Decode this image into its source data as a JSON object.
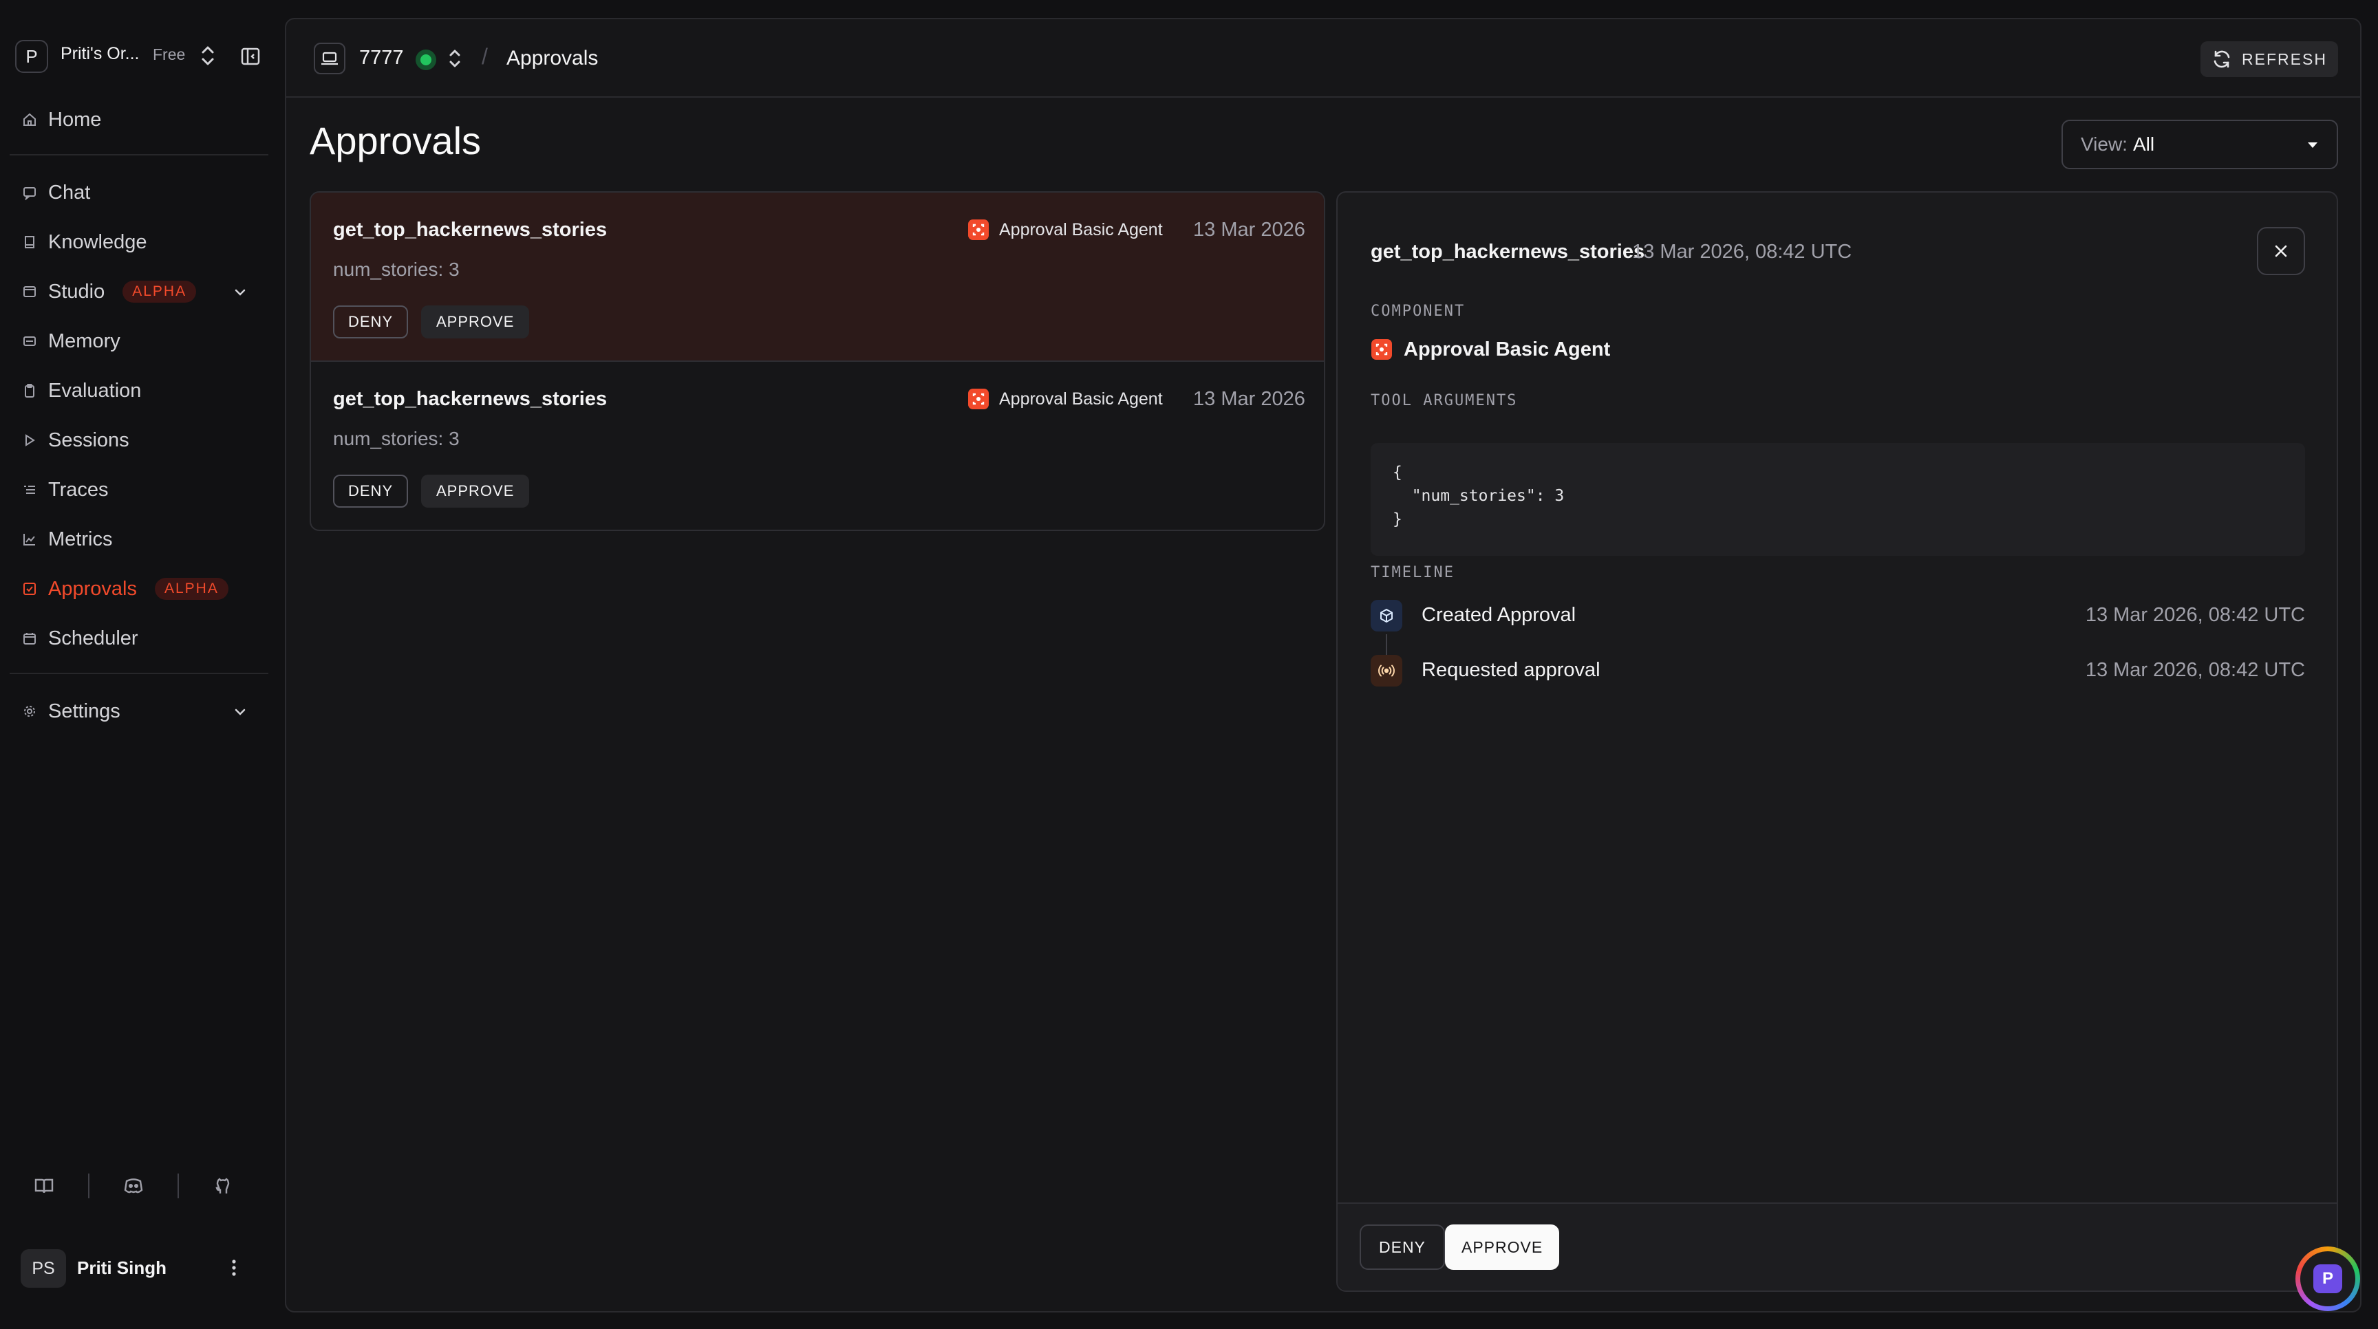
{
  "sidebar": {
    "org": {
      "initial": "P",
      "name": "Priti's Or...",
      "plan": "Free"
    },
    "nav": {
      "home": "Home",
      "chat": "Chat",
      "knowledge": "Knowledge",
      "studio": "Studio",
      "studio_badge": "ALPHA",
      "memory": "Memory",
      "evaluation": "Evaluation",
      "sessions": "Sessions",
      "traces": "Traces",
      "metrics": "Metrics",
      "approvals": "Approvals",
      "approvals_badge": "ALPHA",
      "scheduler": "Scheduler",
      "settings": "Settings"
    },
    "active_item": "approvals",
    "user": {
      "initials": "PS",
      "name": "Priti Singh"
    }
  },
  "topbar": {
    "env_name": "7777",
    "env_status": "online",
    "breadcrumb_separator": "/",
    "breadcrumb_page": "Approvals",
    "refresh_label": "REFRESH"
  },
  "page": {
    "title": "Approvals",
    "view_label": "View:",
    "view_value": "All"
  },
  "approvals": [
    {
      "tool": "get_top_hackernews_stories",
      "args": "num_stories: 3",
      "agent": "Approval Basic Agent",
      "date": "13 Mar 2026",
      "deny_label": "DENY",
      "approve_label": "APPROVE",
      "selected": true
    },
    {
      "tool": "get_top_hackernews_stories",
      "args": "num_stories: 3",
      "agent": "Approval Basic Agent",
      "date": "13 Mar 2026",
      "deny_label": "DENY",
      "approve_label": "APPROVE",
      "selected": false
    }
  ],
  "detail": {
    "tool": "get_top_hackernews_stories",
    "datetime": "13 Mar 2026, 08:42 UTC",
    "component_heading": "COMPONENT",
    "component_name": "Approval Basic Agent",
    "args_heading": "TOOL ARGUMENTS",
    "args_code": "{\n  \"num_stories\": 3\n}",
    "timeline_heading": "TIMELINE",
    "timeline": [
      {
        "label": "Created Approval",
        "time": "13 Mar 2026, 08:42 UTC",
        "icon": "cube-icon"
      },
      {
        "label": "Requested approval",
        "time": "13 Mar 2026, 08:42 UTC",
        "icon": "broadcast-icon"
      }
    ],
    "deny_label": "DENY",
    "approve_label": "APPROVE"
  },
  "fab": {
    "initial": "P"
  },
  "colors": {
    "accent": "#f24a2b",
    "selected_row": "#2c1a19",
    "status_green": "#22c55e",
    "fab_purple": "#6d4ce6"
  }
}
